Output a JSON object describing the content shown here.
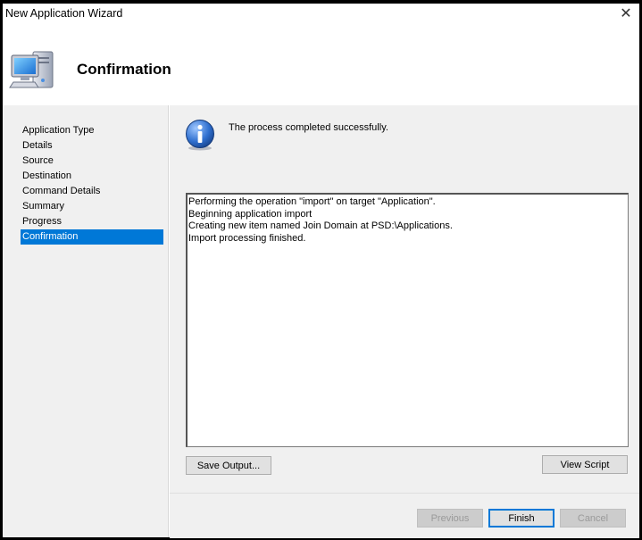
{
  "window": {
    "title": "New Application Wizard",
    "close_glyph": "✕"
  },
  "header": {
    "title": "Confirmation",
    "icon": "computer-icon"
  },
  "sidebar": {
    "items": [
      {
        "label": "Application Type",
        "active": false
      },
      {
        "label": "Details",
        "active": false
      },
      {
        "label": "Source",
        "active": false
      },
      {
        "label": "Destination",
        "active": false
      },
      {
        "label": "Command Details",
        "active": false
      },
      {
        "label": "Summary",
        "active": false
      },
      {
        "label": "Progress",
        "active": false
      },
      {
        "label": "Confirmation",
        "active": true
      }
    ]
  },
  "content": {
    "status_icon": "info-icon",
    "status_text": "The process completed successfully.",
    "output_lines": [
      "Performing the operation \"import\" on target \"Application\".",
      "Beginning application import",
      "Creating new item named Join Domain at PSD:\\Applications.",
      "Import processing finished."
    ],
    "save_output_label": "Save Output...",
    "view_script_label": "View Script"
  },
  "footer": {
    "previous_label": "Previous",
    "finish_label": "Finish",
    "cancel_label": "Cancel"
  },
  "colors": {
    "accent": "#0078d7",
    "panel": "#f0f0f0"
  }
}
